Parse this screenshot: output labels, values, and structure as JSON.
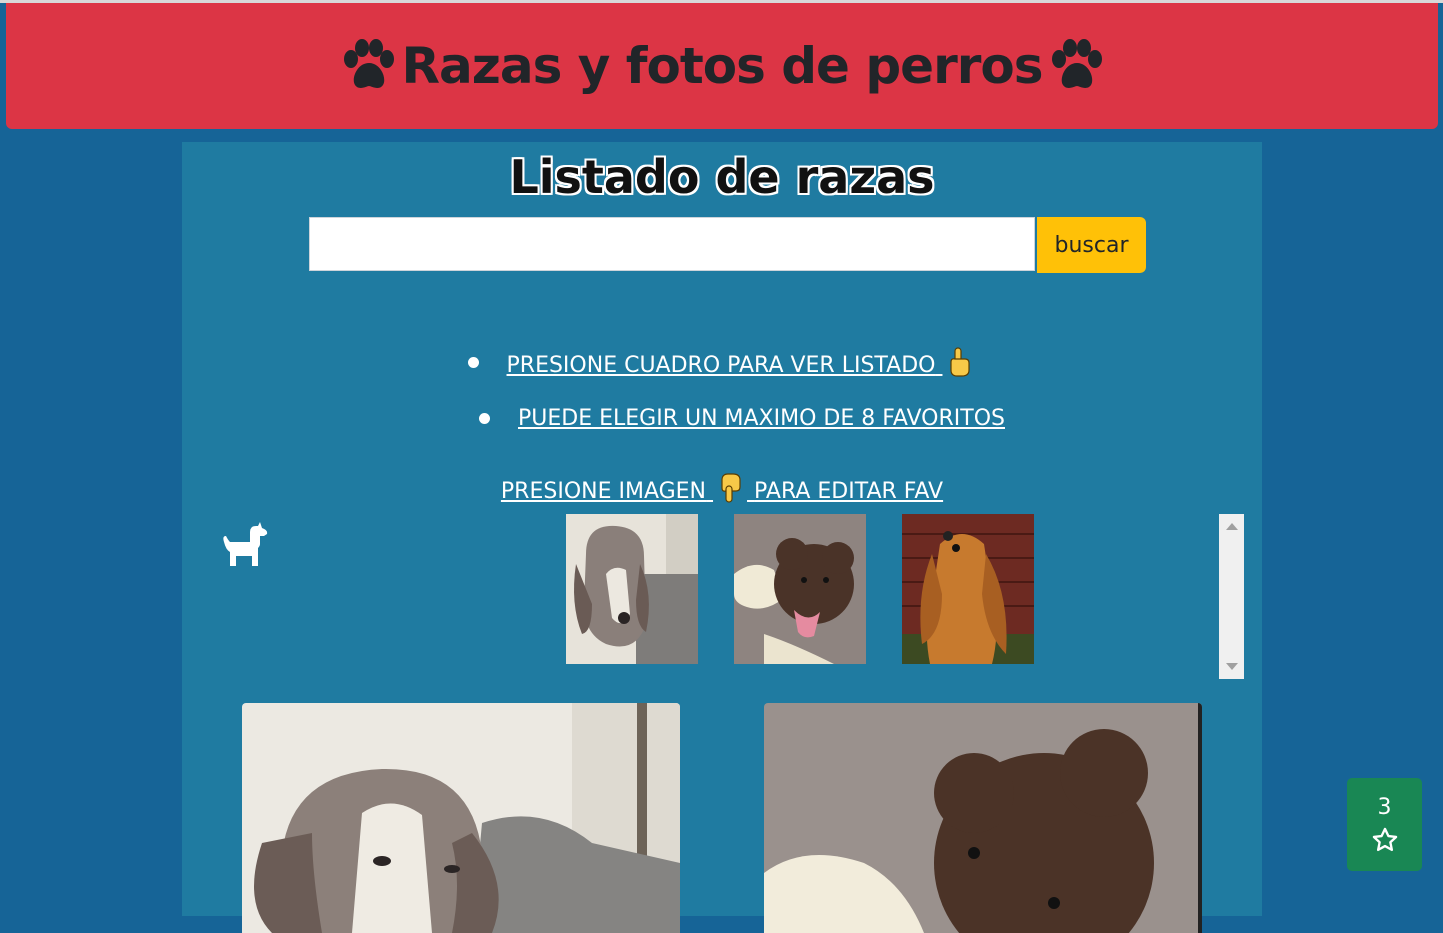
{
  "header": {
    "title": "Razas y fotos de perros",
    "left_icon": "paw-icon",
    "right_icon": "paw-icon",
    "background_color": "#dc3545"
  },
  "main": {
    "section_title": "Listado de razas",
    "search": {
      "value": "",
      "placeholder": "",
      "button_label": "buscar",
      "button_color": "#ffc107"
    },
    "info_items": [
      {
        "text": "PRESIONE CUADRO PARA VER LISTADO",
        "icon": "pointing-up-hand-icon"
      },
      {
        "text": "PUEDE ELEGIR UN MAXIMO DE 8 FAVORITOS"
      }
    ],
    "edit_hint": {
      "before": "PRESIONE IMAGEN",
      "after": "PARA EDITAR FAV",
      "icon": "pointing-down-hand-icon"
    },
    "dog_icon": "dog-icon",
    "favorites_thumbnails": [
      {
        "name": "basset-hound"
      },
      {
        "name": "brown-poodle"
      },
      {
        "name": "cocker-spaniel"
      }
    ],
    "cards": [
      {
        "name": "basset-hound"
      },
      {
        "name": "brown-poodle"
      }
    ]
  },
  "favorites_button": {
    "count": "3",
    "icon": "star-outline-icon",
    "color": "#198754"
  },
  "colors": {
    "page_background": "#166497",
    "panel_background": "#1f7ba1"
  }
}
